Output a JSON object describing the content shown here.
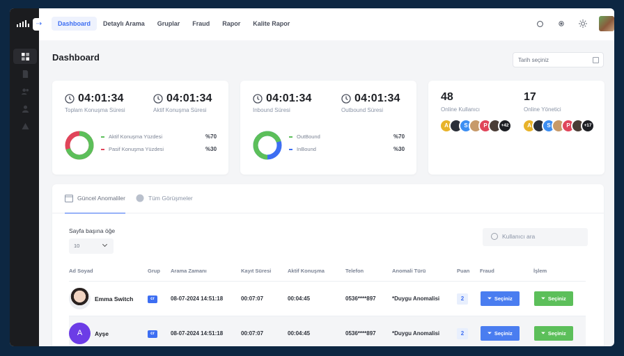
{
  "nav": {
    "items": [
      "Dashboard",
      "Detaylı Arama",
      "Gruplar",
      "Fraud",
      "Rapor",
      "Kalite Rapor"
    ],
    "active": "Dashboard"
  },
  "sidebar": {
    "toggle_icon": "arrow-right-icon",
    "items": [
      "dashboard-icon",
      "document-icon",
      "users-icon",
      "user-icon",
      "warning-icon"
    ]
  },
  "page": {
    "title": "Dashboard",
    "date_placeholder": "Tarih seçiniz"
  },
  "card1": {
    "stat1": {
      "value": "04:01:34",
      "label": "Toplam Konuşma Süresi"
    },
    "stat2": {
      "value": "04:01:34",
      "label": "Aktif Konuşma Süresi"
    },
    "legend": [
      {
        "label": "Aktif Konuşma Yüzdesi",
        "value": "%70",
        "color": "#5cbf5a"
      },
      {
        "label": "Pasif Konuşma Yüzdesi",
        "value": "%30",
        "color": "#e0455a"
      }
    ],
    "donut": {
      "green_pct": 70,
      "red_pct": 30
    }
  },
  "card2": {
    "stat1": {
      "value": "04:01:34",
      "label": "Inbound Süresi"
    },
    "stat2": {
      "value": "04:01:34",
      "label": "Outbound Süresi"
    },
    "legend": [
      {
        "label": "OutBound",
        "value": "%70",
        "color": "#5cbf5a"
      },
      {
        "label": "InBound",
        "value": "%30",
        "color": "#3d6ef2"
      }
    ],
    "donut": {
      "green_pct": 70,
      "blue_pct": 30
    }
  },
  "card3": {
    "users": {
      "count": "48",
      "label": "Online Kullanıcı",
      "more": "+42"
    },
    "admins": {
      "count": "17",
      "label": "Online Yönetici",
      "more": "+17"
    },
    "avatar_letters": [
      "A",
      "S",
      "P"
    ],
    "colors": {
      "a": "#e8b32a",
      "s": "#3d8ef2",
      "p": "#e0455a"
    }
  },
  "table": {
    "tabs": [
      "Güncel Anomaliler",
      "Tüm Görüşmeler"
    ],
    "per_page_label": "Sayfa başına öğe",
    "per_page_value": "10",
    "search_placeholder": "Kullanıcı ara",
    "headers": [
      "Ad Soyad",
      "Grup",
      "Arama Zamanı",
      "Kayıt Süresi",
      "Aktif Konuşma",
      "Telefon",
      "Anomali Türü",
      "Puan",
      "Fraud",
      "İşlem"
    ],
    "rows": [
      {
        "name": "Emma Switch",
        "group": "cr",
        "time": "08-07-2024 14:51:18",
        "record": "00:07:07",
        "active": "00:04:45",
        "phone": "0536****897",
        "anomaly": "*Duygu Anomalisi",
        "score": "2",
        "fraud_btn": "Seçiniz",
        "action_btn": "Seçiniz"
      },
      {
        "name": "Ayşe",
        "initial": "A",
        "group": "cr",
        "time": "08-07-2024 14:51:18",
        "record": "00:07:07",
        "active": "00:04:45",
        "phone": "0536****897",
        "anomaly": "*Duygu Anomalisi",
        "score": "2",
        "fraud_btn": "Seçiniz",
        "action_btn": "Seçiniz"
      }
    ]
  }
}
